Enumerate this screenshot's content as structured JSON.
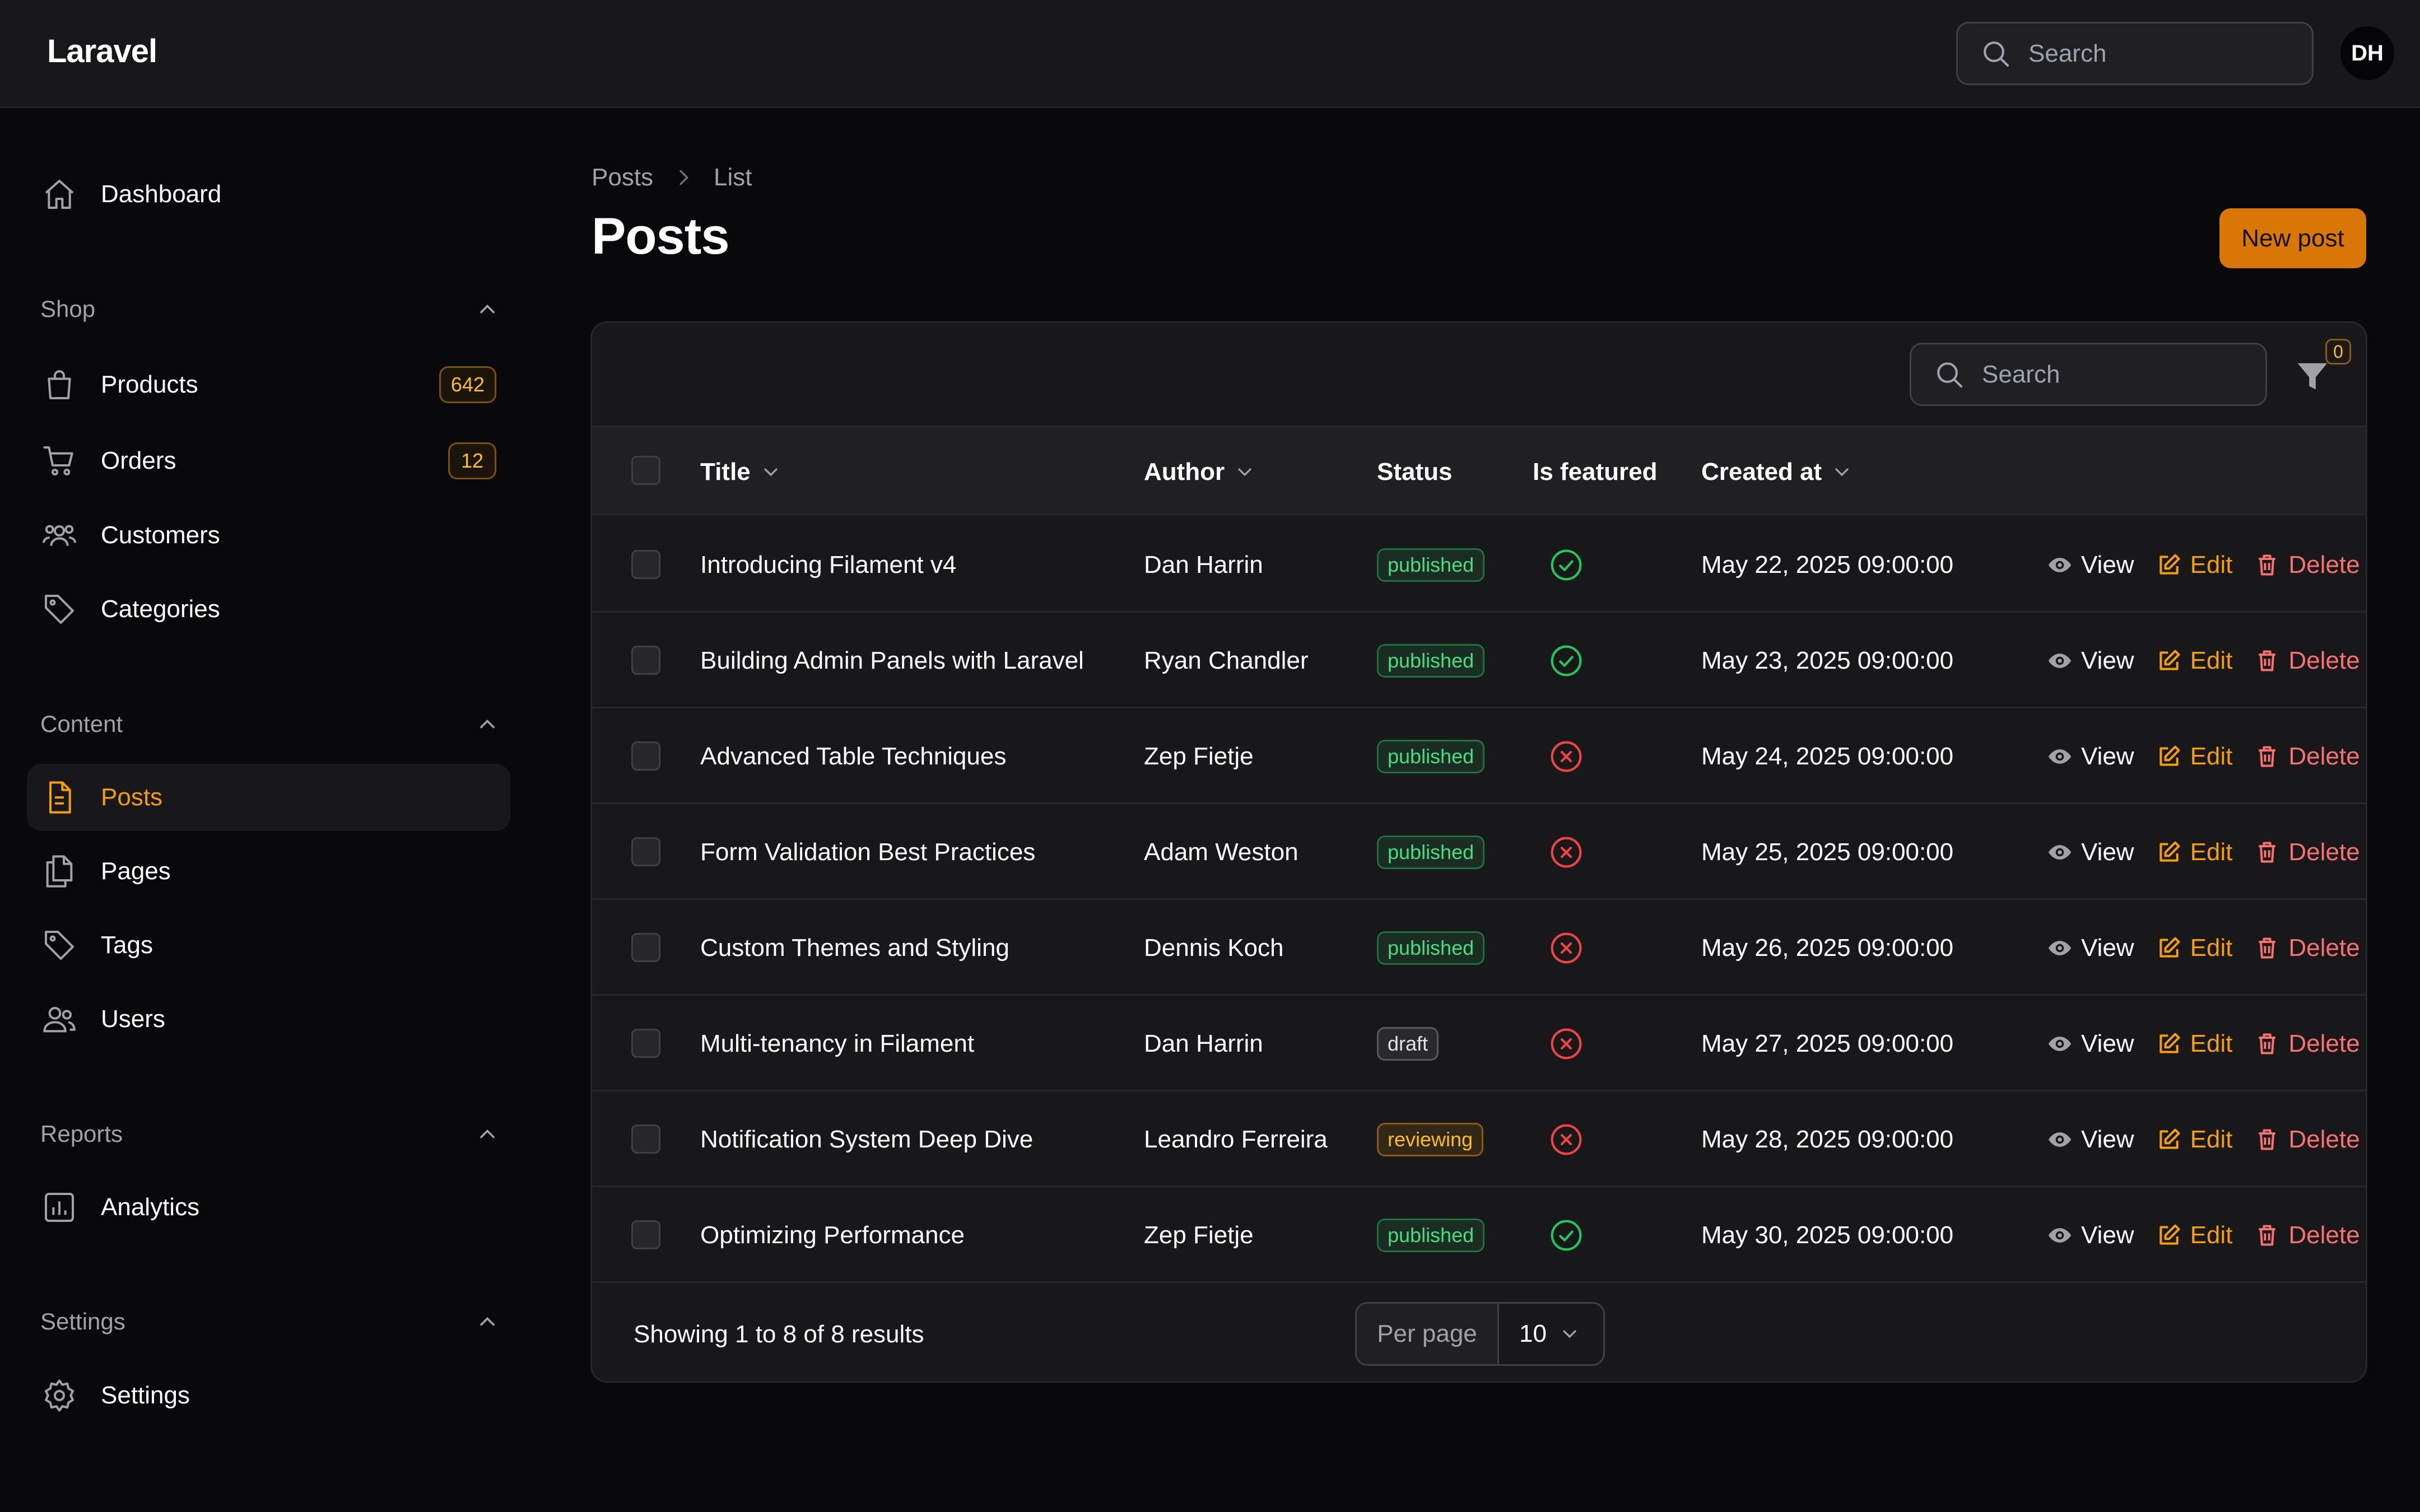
{
  "app": {
    "brand": "Laravel"
  },
  "topbar": {
    "search_placeholder": "Search",
    "avatar_initials": "DH"
  },
  "sidebar": {
    "dashboard": {
      "label": "Dashboard",
      "icon": "home-icon"
    },
    "groups": [
      {
        "label": "Shop",
        "items": [
          {
            "label": "Products",
            "icon": "shopping-bag-icon",
            "badge": "642"
          },
          {
            "label": "Orders",
            "icon": "shopping-cart-icon",
            "badge": "12"
          },
          {
            "label": "Customers",
            "icon": "user-group-icon"
          },
          {
            "label": "Categories",
            "icon": "tag-icon"
          }
        ]
      },
      {
        "label": "Content",
        "items": [
          {
            "label": "Posts",
            "icon": "document-text-icon",
            "active": true
          },
          {
            "label": "Pages",
            "icon": "documents-icon"
          },
          {
            "label": "Tags",
            "icon": "tag-icon"
          },
          {
            "label": "Users",
            "icon": "users-icon"
          }
        ]
      },
      {
        "label": "Reports",
        "items": [
          {
            "label": "Analytics",
            "icon": "chart-bar-icon"
          }
        ]
      },
      {
        "label": "Settings",
        "items": [
          {
            "label": "Settings",
            "icon": "cog-icon"
          }
        ]
      }
    ]
  },
  "breadcrumb": [
    "Posts",
    "List"
  ],
  "page": {
    "title": "Posts",
    "new_button": "New post"
  },
  "table": {
    "search_placeholder": "Search",
    "filter_count": "0",
    "columns": [
      "Title",
      "Author",
      "Status",
      "Is featured",
      "Created at"
    ],
    "actions": {
      "view": "View",
      "edit": "Edit",
      "delete": "Delete"
    },
    "rows": [
      {
        "title": "Introducing Filament v4",
        "author": "Dan Harrin",
        "status": "published",
        "featured": true,
        "created_at": "May 22, 2025 09:00:00"
      },
      {
        "title": "Building Admin Panels with Laravel",
        "author": "Ryan Chandler",
        "status": "published",
        "featured": true,
        "created_at": "May 23, 2025 09:00:00"
      },
      {
        "title": "Advanced Table Techniques",
        "author": "Zep Fietje",
        "status": "published",
        "featured": false,
        "created_at": "May 24, 2025 09:00:00"
      },
      {
        "title": "Form Validation Best Practices",
        "author": "Adam Weston",
        "status": "published",
        "featured": false,
        "created_at": "May 25, 2025 09:00:00"
      },
      {
        "title": "Custom Themes and Styling",
        "author": "Dennis Koch",
        "status": "published",
        "featured": false,
        "created_at": "May 26, 2025 09:00:00"
      },
      {
        "title": "Multi-tenancy in Filament",
        "author": "Dan Harrin",
        "status": "draft",
        "featured": false,
        "created_at": "May 27, 2025 09:00:00"
      },
      {
        "title": "Notification System Deep Dive",
        "author": "Leandro Ferreira",
        "status": "reviewing",
        "featured": false,
        "created_at": "May 28, 2025 09:00:00"
      },
      {
        "title": "Optimizing Performance",
        "author": "Zep Fietje",
        "status": "published",
        "featured": true,
        "created_at": "May 30, 2025 09:00:00"
      }
    ],
    "footer": {
      "showing": "Showing 1 to 8 of 8 results",
      "per_page_label": "Per page",
      "per_page_value": "10"
    }
  },
  "colors": {
    "accent": "#f59e0b",
    "success": "#22c55e",
    "danger": "#ef4444",
    "background": "#09090b",
    "panel": "#18181b"
  }
}
